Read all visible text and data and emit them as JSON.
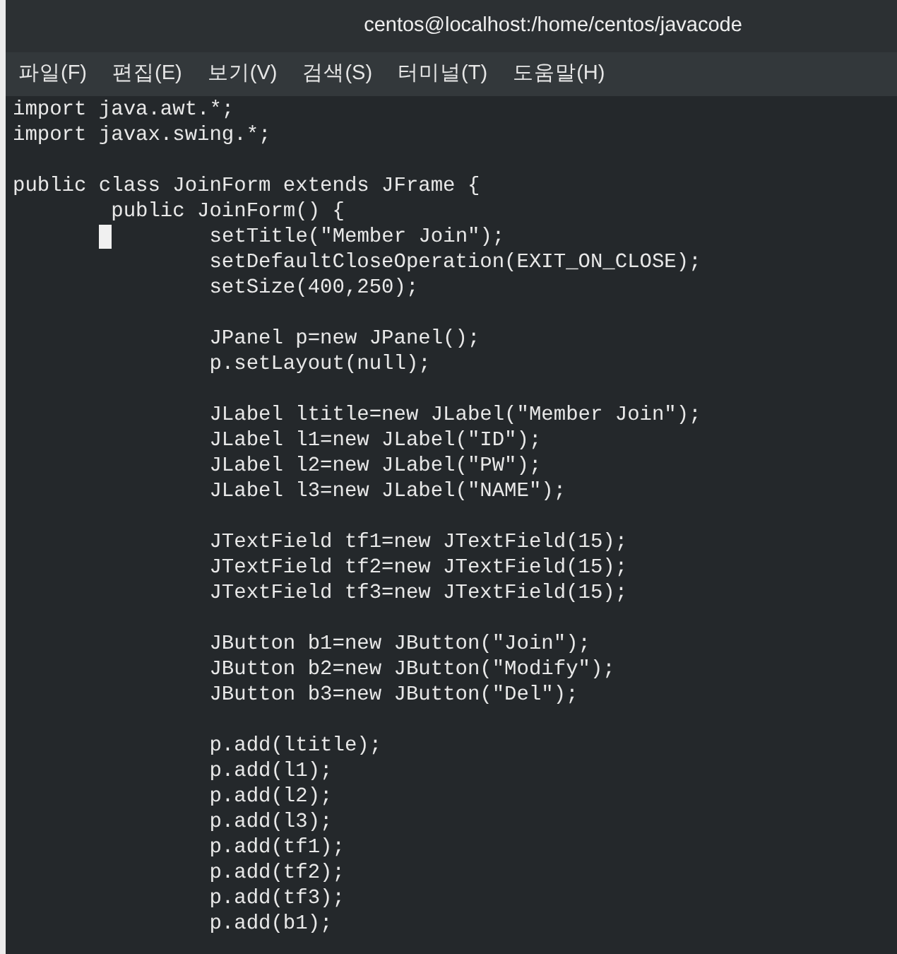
{
  "window": {
    "title": "centos@localhost:/home/centos/javacode"
  },
  "menu": [
    "파일(F)",
    "편집(E)",
    "보기(V)",
    "검색(S)",
    "터미널(T)",
    "도움말(H)"
  ],
  "lines": [
    {
      "kind": "code",
      "text": "import java.awt.*;"
    },
    {
      "kind": "code",
      "text": "import javax.swing.*;"
    },
    {
      "kind": "blank"
    },
    {
      "kind": "code",
      "text": "public class JoinForm extends JFrame {"
    },
    {
      "kind": "code",
      "text": "        public JoinForm() {"
    },
    {
      "kind": "cursor",
      "after": "        setTitle(\"Member Join\");"
    },
    {
      "kind": "code",
      "text": "                setDefaultCloseOperation(EXIT_ON_CLOSE);"
    },
    {
      "kind": "code",
      "text": "                setSize(400,250);"
    },
    {
      "kind": "blank"
    },
    {
      "kind": "code",
      "text": "                JPanel p=new JPanel();"
    },
    {
      "kind": "code",
      "text": "                p.setLayout(null);"
    },
    {
      "kind": "blank"
    },
    {
      "kind": "code",
      "text": "                JLabel ltitle=new JLabel(\"Member Join\");"
    },
    {
      "kind": "code",
      "text": "                JLabel l1=new JLabel(\"ID\");"
    },
    {
      "kind": "code",
      "text": "                JLabel l2=new JLabel(\"PW\");"
    },
    {
      "kind": "code",
      "text": "                JLabel l3=new JLabel(\"NAME\");"
    },
    {
      "kind": "blank"
    },
    {
      "kind": "code",
      "text": "                JTextField tf1=new JTextField(15);"
    },
    {
      "kind": "code",
      "text": "                JTextField tf2=new JTextField(15);"
    },
    {
      "kind": "code",
      "text": "                JTextField tf3=new JTextField(15);"
    },
    {
      "kind": "blank"
    },
    {
      "kind": "code",
      "text": "                JButton b1=new JButton(\"Join\");"
    },
    {
      "kind": "code",
      "text": "                JButton b2=new JButton(\"Modify\");"
    },
    {
      "kind": "code",
      "text": "                JButton b3=new JButton(\"Del\");"
    },
    {
      "kind": "blank"
    },
    {
      "kind": "code",
      "text": "                p.add(ltitle);"
    },
    {
      "kind": "code",
      "text": "                p.add(l1);"
    },
    {
      "kind": "code",
      "text": "                p.add(l2);"
    },
    {
      "kind": "code",
      "text": "                p.add(l3);"
    },
    {
      "kind": "code",
      "text": "                p.add(tf1);"
    },
    {
      "kind": "code",
      "text": "                p.add(tf2);"
    },
    {
      "kind": "code",
      "text": "                p.add(tf3);"
    },
    {
      "kind": "code",
      "text": "                p.add(b1);"
    }
  ]
}
